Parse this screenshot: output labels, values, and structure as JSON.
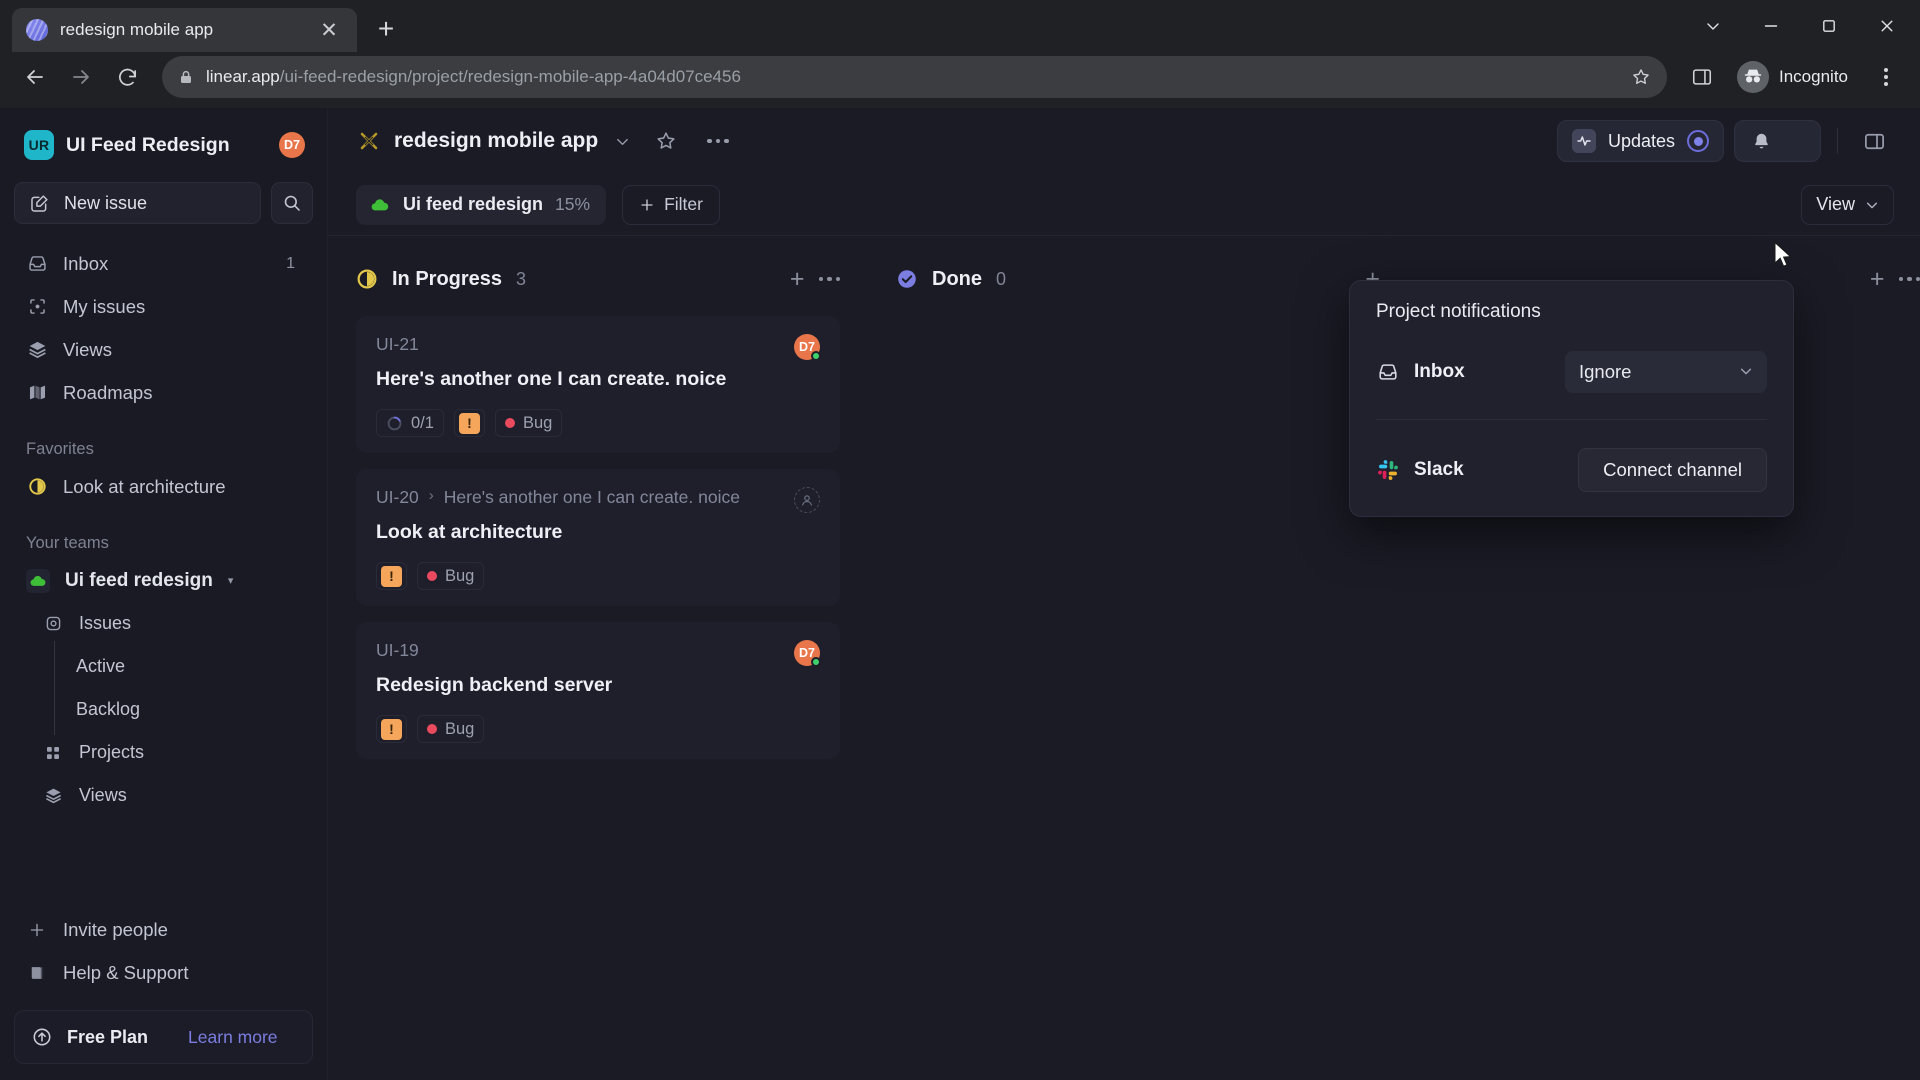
{
  "browser": {
    "tab": {
      "title": "redesign mobile app",
      "favicon": "linear-logo-icon",
      "close": "✕"
    },
    "new_tab_label": "+",
    "window_controls": [
      "minimize-chevron",
      "minimize",
      "maximize",
      "close"
    ],
    "url_domain": "linear.app",
    "url_path": "/ui-feed-redesign/project/redesign-mobile-app-4a04d07ce456",
    "incognito_label": "Incognito"
  },
  "sidebar": {
    "workspace": {
      "initials": "UR",
      "name": "UI Feed Redesign",
      "avatar_badge": "D7",
      "avatar_color": "#e8764a"
    },
    "new_issue_label": "New issue",
    "search_label": "search-icon",
    "nav": [
      {
        "label": "Inbox",
        "icon": "inbox-icon",
        "count": "1"
      },
      {
        "label": "My issues",
        "icon": "my-issues-icon",
        "count": ""
      },
      {
        "label": "Views",
        "icon": "views-layers-icon",
        "count": ""
      },
      {
        "label": "Roadmaps",
        "icon": "roadmaps-map-icon",
        "count": ""
      }
    ],
    "favorites_label": "Favorites",
    "favorites": [
      {
        "label": "Look at architecture",
        "icon": "in-progress-half-circle-icon",
        "color": "#e2c74a"
      }
    ],
    "teams_label": "Your teams",
    "team": {
      "name": "Ui feed redesign",
      "icon": "green-cloud-icon",
      "caret": "▾"
    },
    "team_items": [
      {
        "label": "Issues",
        "icon": "issues-icon",
        "level": "sub"
      },
      {
        "label": "Active",
        "icon": "",
        "level": "subsub"
      },
      {
        "label": "Backlog",
        "icon": "",
        "level": "subsub"
      },
      {
        "label": "Projects",
        "icon": "projects-grid-icon",
        "level": "sub"
      },
      {
        "label": "Views",
        "icon": "views-layers-icon",
        "level": "sub"
      }
    ],
    "bottom": [
      {
        "label": "Invite people",
        "icon": "plus-icon"
      },
      {
        "label": "Help & Support",
        "icon": "book-icon"
      }
    ],
    "plan": {
      "name": "Free Plan",
      "link": "Learn more",
      "icon": "upgrade-arrow-icon",
      "link_color": "#7b7de0"
    }
  },
  "header": {
    "project_icon": "crossed-pencils-icon",
    "project_title": "redesign mobile app",
    "title_caret": "⌄",
    "star_icon": "star-icon",
    "more_icon": "more-horizontal-icon",
    "updates_label": "Updates",
    "updates_icon": "activity-pulse-icon",
    "updates_indicator": "unread-dot",
    "bell_icon": "bell-icon",
    "panel_icon": "right-panel-icon"
  },
  "filter_bar": {
    "progress_chip": {
      "icon": "green-cloud-icon",
      "name": "Ui feed redesign",
      "percent": "15%"
    },
    "filter_label": "Filter",
    "filter_icon": "plus-icon",
    "view_label": "View",
    "view_caret": "⌄"
  },
  "board": {
    "columns": [
      {
        "title": "In Progress",
        "count": "3",
        "status_icon": "in-progress-half-circle-icon",
        "status_color": "#e2c74a",
        "add_icon": "plus-icon",
        "more_icon": "more-horizontal-icon",
        "cards": [
          {
            "id": "UI-21",
            "parent": "",
            "title": "Here's another one I can create. noice",
            "avatar": "D7",
            "avatar_type": "initials",
            "online": true,
            "meta": [
              {
                "type": "progress",
                "label": "0/1",
                "icon": "progress-ring-icon"
              },
              {
                "type": "priority",
                "label": "!",
                "icon": "urgent-priority-icon"
              },
              {
                "type": "label",
                "label": "Bug",
                "color": "#ea4a5e"
              }
            ]
          },
          {
            "id": "UI-20",
            "parent": "Here's another one I can create. noice",
            "title": "Look at architecture",
            "avatar": "",
            "avatar_type": "empty",
            "online": false,
            "meta": [
              {
                "type": "priority",
                "label": "!",
                "icon": "urgent-priority-icon"
              },
              {
                "type": "label",
                "label": "Bug",
                "color": "#ea4a5e"
              }
            ]
          },
          {
            "id": "UI-19",
            "parent": "",
            "title": "Redesign backend server",
            "avatar": "D7",
            "avatar_type": "initials",
            "online": true,
            "meta": [
              {
                "type": "priority",
                "label": "!",
                "icon": "urgent-priority-icon"
              },
              {
                "type": "label",
                "label": "Bug",
                "color": "#ea4a5e"
              }
            ]
          }
        ]
      },
      {
        "title": "Done",
        "count": "0",
        "status_icon": "done-check-circle-icon",
        "status_color": "#7b7de0",
        "add_icon": "plus-icon",
        "more_icon": "",
        "cards": []
      },
      {
        "title": "",
        "count": "",
        "status_icon": "",
        "status_color": "",
        "add_icon": "plus-icon",
        "more_icon": "more-horizontal-icon",
        "cards": []
      }
    ]
  },
  "notifications_popup": {
    "title": "Project notifications",
    "inbox": {
      "label": "Inbox",
      "icon": "inbox-icon",
      "value": "Ignore",
      "caret": "⌄"
    },
    "slack": {
      "label": "Slack",
      "icon": "slack-icon",
      "button": "Connect channel"
    }
  }
}
